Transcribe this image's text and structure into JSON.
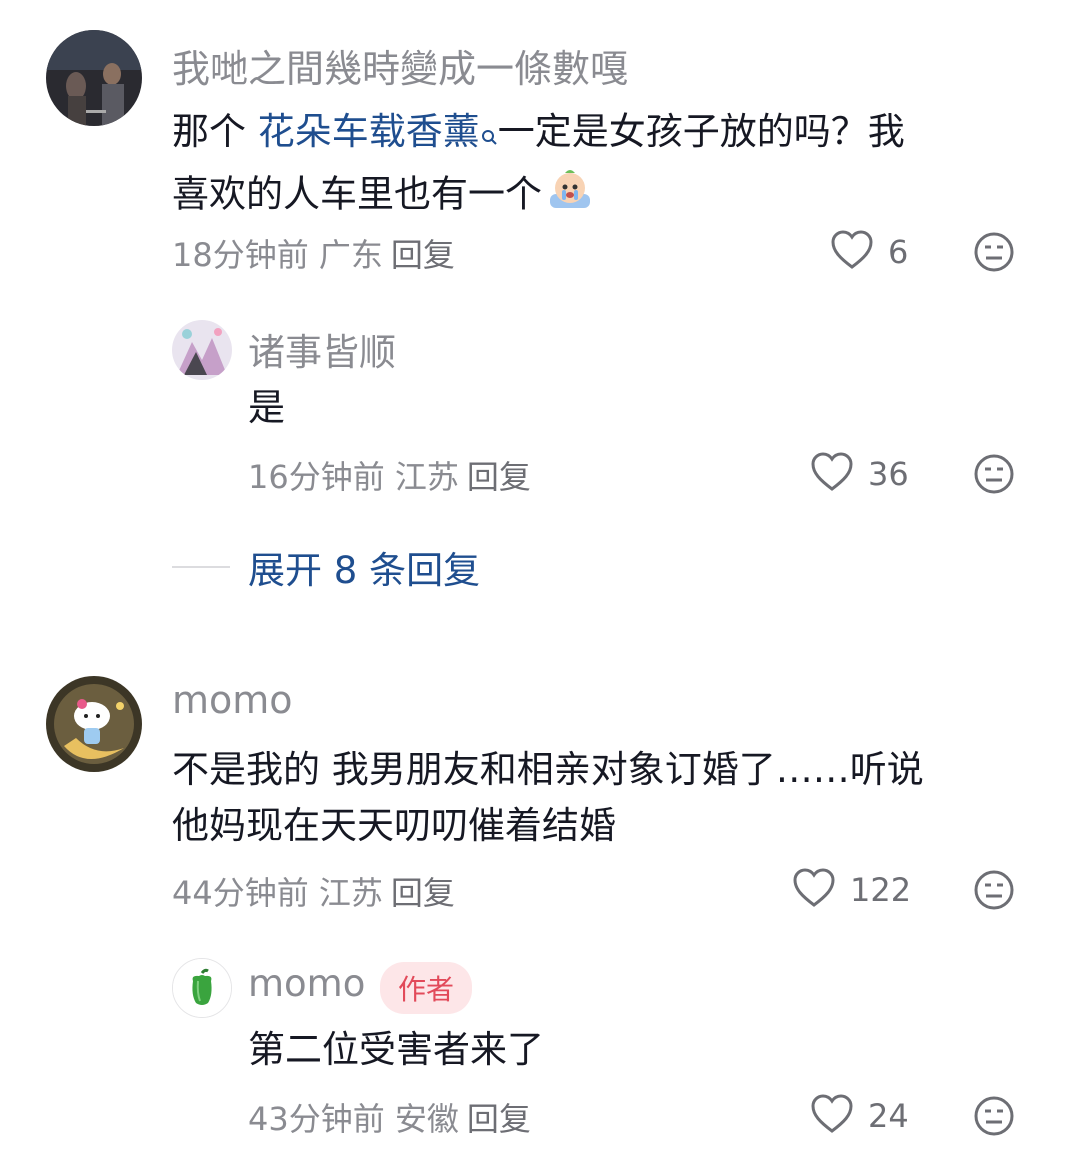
{
  "comments": [
    {
      "username": "我哋之間幾時變成一條數嘎",
      "text_prefix": "那个 ",
      "keyword": "花朵车载香薰",
      "text_line1_rest": "一定是女孩子放的吗？我",
      "text_line2": "喜欢的人车里也有一个",
      "time_location": "18分钟前 广东",
      "reply_label": "回复",
      "likes": "6"
    },
    {
      "username": "诸事皆顺",
      "text": "是",
      "time_location": "16分钟前 江苏",
      "reply_label": "回复",
      "likes": "36"
    },
    {
      "username": "momo",
      "text_line1": "不是我的 我男朋友和相亲对象订婚了……听说",
      "text_line2": "他妈现在天天叨叨催着结婚",
      "time_location": "44分钟前 江苏",
      "reply_label": "回复",
      "likes": "122"
    },
    {
      "username": "momo",
      "badge": "作者",
      "text": "第二位受害者来了",
      "time_location": "43分钟前 安徽",
      "reply_label": "回复",
      "likes": "24"
    }
  ],
  "expand_replies": "展开 8 条回复",
  "colors": {
    "link": "#1f4e8f",
    "meta": "#8a8b91",
    "badge_bg": "#fde6e8",
    "badge_text": "#e24a5a"
  },
  "icons": [
    "heart-outline-icon",
    "dislike-face-icon",
    "search-mini-icon",
    "crying-emoji-icon"
  ]
}
